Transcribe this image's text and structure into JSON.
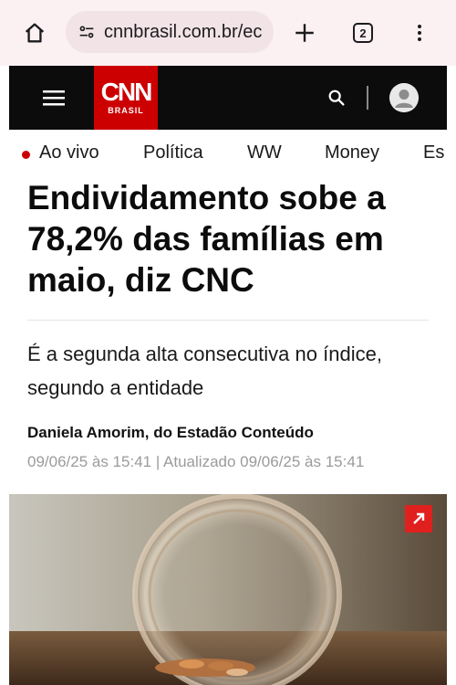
{
  "browser": {
    "url": "cnnbrasil.com.br/ec",
    "tab_count": "2",
    "icons": [
      "home-icon",
      "site-settings-icon",
      "plus-icon",
      "tabs-icon",
      "more-vert-icon"
    ]
  },
  "site_header": {
    "logo_main": "CNN",
    "logo_sub": "BRASIL",
    "icons": [
      "hamburger-menu-icon",
      "search-icon",
      "user-avatar-icon"
    ],
    "colors": {
      "header_bg": "#0c0c0c",
      "logo_red": "#cc0000"
    }
  },
  "nav": {
    "items": [
      "Ao vivo",
      "Política",
      "WW",
      "Money",
      "Es"
    ]
  },
  "article": {
    "headline": "Endividamento sobe a 78,2% das famílias em maio, diz CNC",
    "subtitle": "É a segunda alta consecutiva no índice, segundo a entidade",
    "byline": "Daniela Amorim, do Estadão Conteúdo",
    "dateline": "09/06/25 às 15:41 | Atualizado 09/06/25 às 15:41",
    "image": {
      "expand_icon": "expand-arrow-icon"
    }
  }
}
